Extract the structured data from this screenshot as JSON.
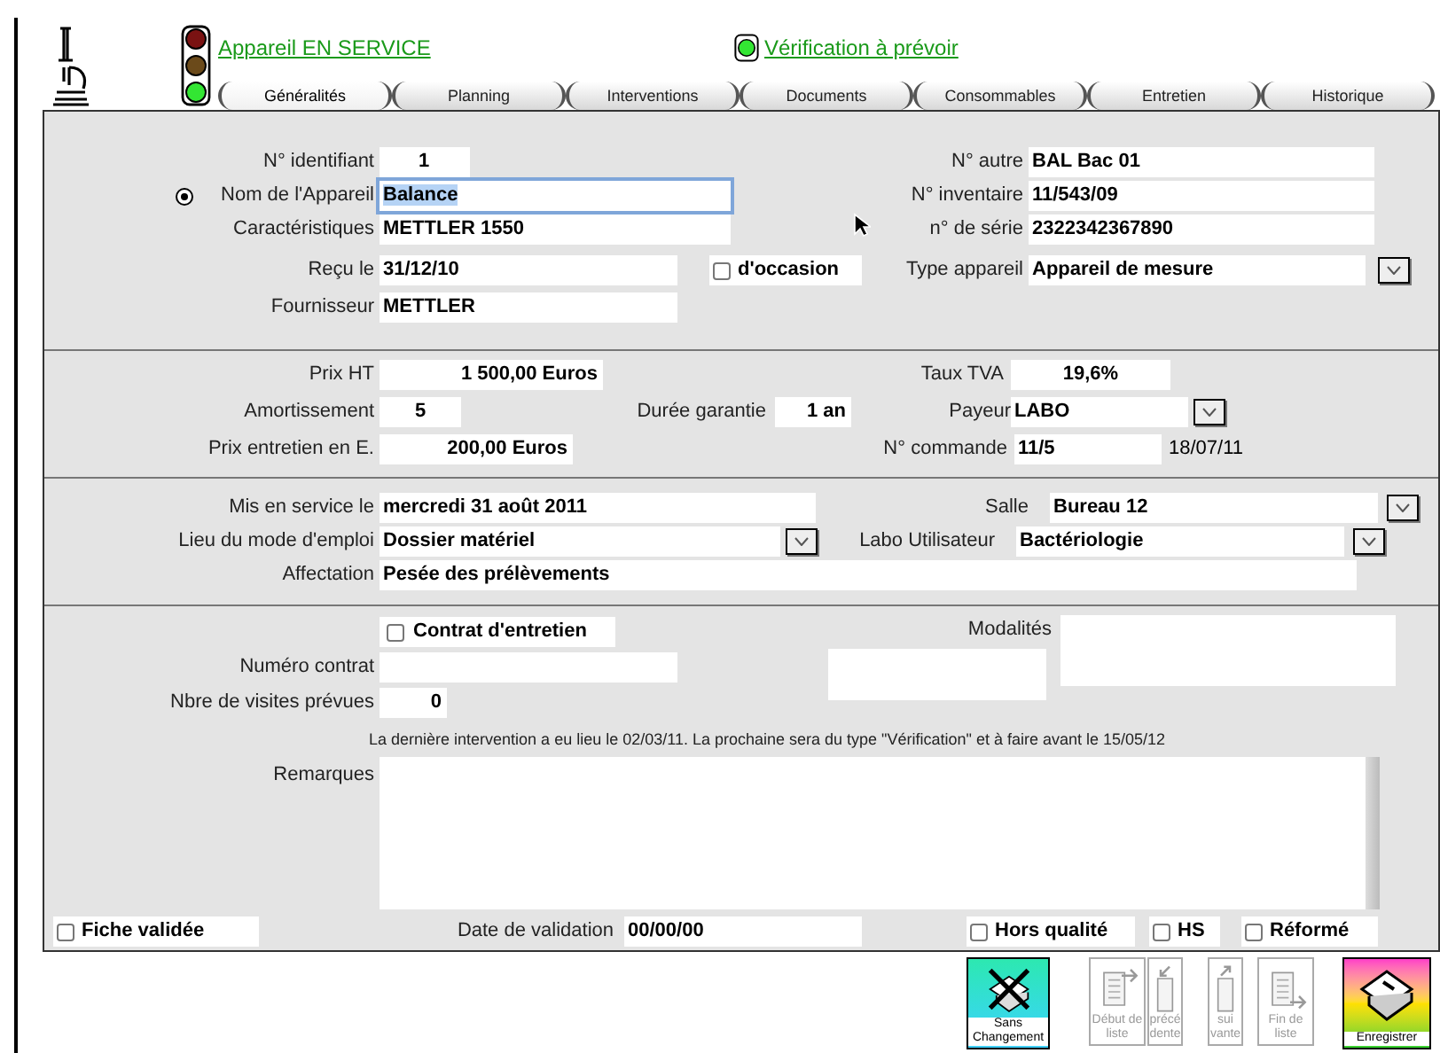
{
  "header": {
    "status_link": "Appareil EN SERVICE",
    "check_link": "Vérification à prévoir"
  },
  "tabs": [
    {
      "label": "Généralités",
      "selected": true
    },
    {
      "label": "Planning",
      "selected": false
    },
    {
      "label": "Interventions",
      "selected": false
    },
    {
      "label": "Documents",
      "selected": false
    },
    {
      "label": "Consommables",
      "selected": false
    },
    {
      "label": "Entretien",
      "selected": false
    },
    {
      "label": "Historique",
      "selected": false
    }
  ],
  "identification": {
    "id": {
      "label": "N°  identifiant",
      "value": "1"
    },
    "other_no": {
      "label": "N°  autre",
      "value": "BAL Bac 01"
    },
    "name": {
      "label": "Nom de l'Appareil",
      "value": "Balance",
      "focused": true,
      "radio_selected": true
    },
    "inventory": {
      "label": "N°  inventaire",
      "value": "11/543/09"
    },
    "characteristics": {
      "label": "Caractéristiques",
      "value": "METTLER 1550"
    },
    "serial": {
      "label": "n° de série",
      "value": "2322342367890"
    },
    "received": {
      "label": "Reçu le",
      "value": "31/12/10"
    },
    "second_hand": {
      "label": "d'occasion",
      "checked": false
    },
    "type": {
      "label": "Type appareil",
      "value": "Appareil de mesure"
    },
    "supplier": {
      "label": "Fournisseur",
      "value": "METTLER"
    }
  },
  "costs": {
    "price": {
      "label": "Prix HT",
      "value": "1 500,00 Euros"
    },
    "vat": {
      "label": "Taux TVA",
      "value": "19,6%"
    },
    "depreciation": {
      "label": "Amortissement",
      "value": "5"
    },
    "warranty": {
      "label": "Durée garantie",
      "value": "1 an"
    },
    "payer": {
      "label": "Payeur",
      "value": "LABO"
    },
    "maintenance_price": {
      "label": "Prix entretien en E.",
      "value": "200,00 Euros"
    },
    "order": {
      "label": "N°  commande",
      "value": "11/5",
      "date": "18/07/11"
    }
  },
  "usage": {
    "service_date": {
      "label": "Mis en service le",
      "value": "mercredi 31 août 2011"
    },
    "room": {
      "label": "Salle",
      "value": "Bureau 12"
    },
    "manual": {
      "label": "Lieu du mode d'emploi",
      "value": "Dossier matériel"
    },
    "lab": {
      "label": "Labo Utilisateur",
      "value": "Bactériologie"
    },
    "assignment": {
      "label": "Affectation",
      "value": "Pesée des prélèvements"
    }
  },
  "maintenance": {
    "contract": {
      "label": "Contrat d'entretien",
      "checked": false
    },
    "modalities": {
      "label": "Modalités"
    },
    "contract_no": {
      "label": "Numéro contrat"
    },
    "visits": {
      "label": "Nbre de visites prévues",
      "value": "0"
    },
    "info": "La dernière intervention a eu lieu le 02/03/11. La prochaine sera du type \"Vérification\" et à faire avant le 15/05/12",
    "remarks": {
      "label": "Remarques"
    },
    "validated": {
      "label": "Fiche validée",
      "checked": false
    },
    "validation_date": {
      "label": "Date de validation",
      "value": "00/00/00"
    },
    "out_of_quality": {
      "label": "Hors qualité",
      "checked": false
    },
    "hs": {
      "label": "HS",
      "checked": false
    },
    "retired": {
      "label": "Réformé",
      "checked": false
    }
  },
  "buttons": [
    {
      "kind": "cancel",
      "label": "Sans Changement",
      "disabled": false
    },
    {
      "kind": "first",
      "label": "Début de liste",
      "disabled": true
    },
    {
      "kind": "previous",
      "label": "précé dente",
      "disabled": true
    },
    {
      "kind": "next",
      "label": "sui vante",
      "disabled": true
    },
    {
      "kind": "last",
      "label": "Fin de liste",
      "disabled": true
    },
    {
      "kind": "save",
      "label": "Enregistrer",
      "disabled": false
    }
  ]
}
